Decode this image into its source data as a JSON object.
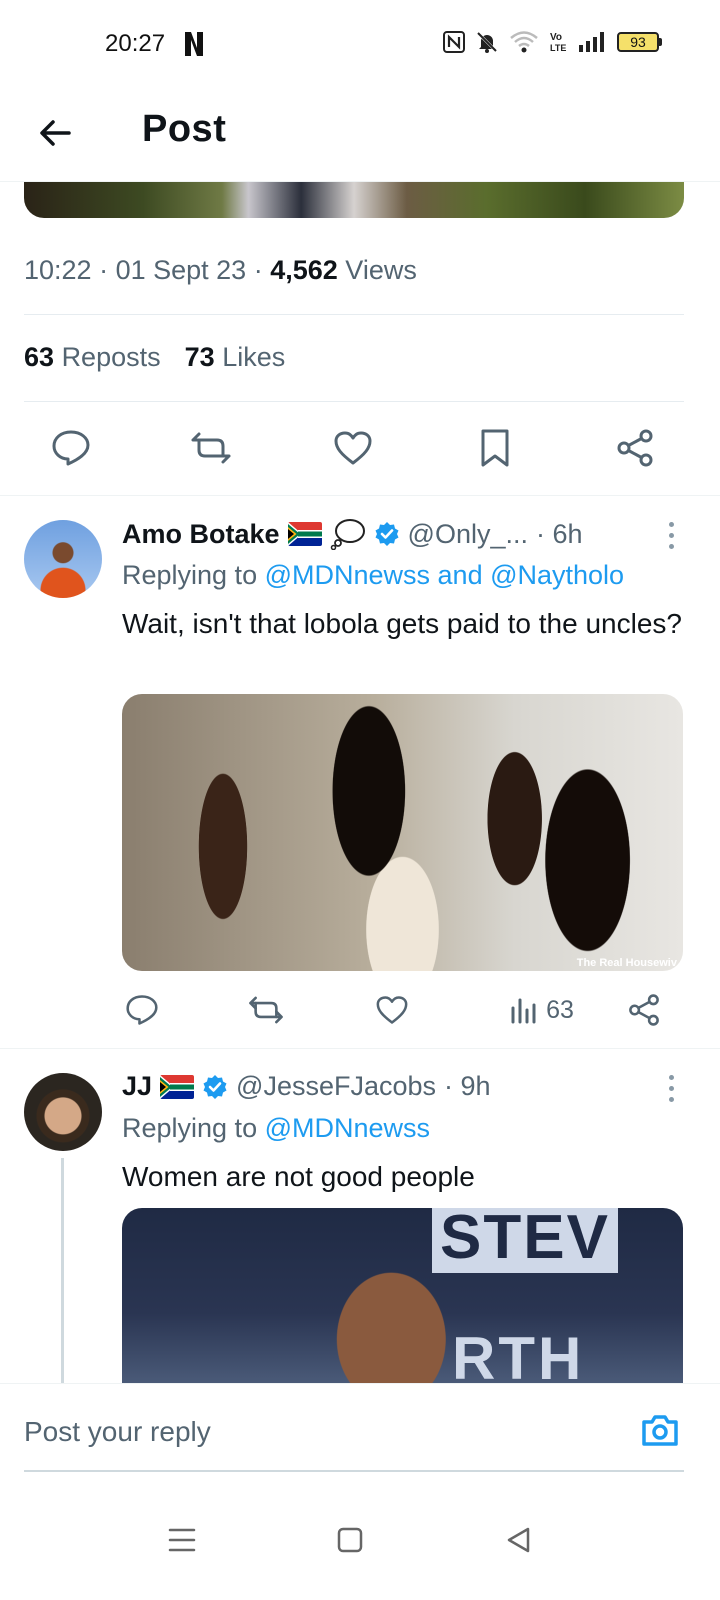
{
  "status_bar": {
    "time": "20:27",
    "battery": "93"
  },
  "header": {
    "title": "Post"
  },
  "post": {
    "time": "10:22",
    "date": "01 Sept 23",
    "views_count": "4,562",
    "views_label": "Views",
    "reposts_count": "63",
    "reposts_label": "Reposts",
    "likes_count": "73",
    "likes_label": "Likes"
  },
  "replies": [
    {
      "name": "Amo Botake",
      "handle": "@Only_...",
      "time": "· 6h",
      "replying_prefix": "Replying to",
      "replying_to": "@MDNnewss and @Naytholo",
      "text": "Wait, isn't that lobola gets paid to the uncles?",
      "media_caption": "The Real Housewiv",
      "views": "63"
    },
    {
      "name": "JJ",
      "handle": "@JesseFJacobs",
      "time": "· 9h",
      "replying_prefix": "Replying to",
      "replying_to": "@MDNnewss",
      "text": "Women are not good people",
      "media_text_top": "STEV",
      "media_text_bottom": "RTH"
    }
  ],
  "composer": {
    "placeholder": "Post your reply"
  },
  "colors": {
    "accent": "#1d9bf0",
    "secondary_text": "#536471"
  }
}
